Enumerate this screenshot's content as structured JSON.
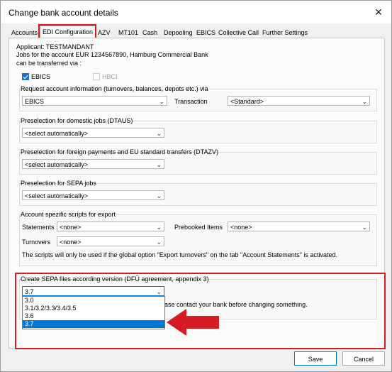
{
  "window": {
    "title": "Change bank account details",
    "close_glyph": "✕"
  },
  "tabs": [
    {
      "label": "Accounts"
    },
    {
      "label": "EDI Configuration"
    },
    {
      "label": "AZV"
    },
    {
      "label": "MT101"
    },
    {
      "label": "Cash"
    },
    {
      "label": "Depooling"
    },
    {
      "label": "EBICS"
    },
    {
      "label": "Collective Call"
    },
    {
      "label": "Further Settings"
    }
  ],
  "header": {
    "applicant": "Applicant: TESTMANDANT",
    "jobs_line": "Jobs for the account EUR 1234567890, Hamburg Commercial Bank",
    "transfer_line": "can be transferred via :",
    "ebics_label": "EBICS",
    "hbci_label": "HBCI"
  },
  "request_info": {
    "legend": "Request account information (turnovers, balances, depots etc.) via",
    "channel_value": "EBICS",
    "transaction_label": "Transaction",
    "transaction_value": "<Standard>"
  },
  "domestic": {
    "legend": "Preselection for domestic jobs (DTAUS)",
    "value": "<select automatically>"
  },
  "foreign": {
    "legend": "Preselection for foreign payments and EU standard transfers (DTAZV)",
    "value": "<select automatically>"
  },
  "sepa_jobs": {
    "legend": "Preselection for SEPA jobs",
    "value": "<select automatically>"
  },
  "scripts": {
    "legend": "Account spezific scripts for export",
    "statements_label": "Statements",
    "statements_value": "<none>",
    "prebooked_label": "Prebooked Items",
    "prebooked_value": "<none>",
    "turnovers_label": "Turnovers",
    "turnovers_value": "<none>",
    "note": "The scripts will only be used if the global option \"Export turnovers\" on the tab \"Account Statements\" is activated."
  },
  "sepa_version": {
    "legend": "Create SEPA files according  version (DFÜ agreement, appendix 3)",
    "value": "3.7",
    "hint_partial": "ase contact your bank before changing something.",
    "options": [
      "3.0",
      "3.1/3.2/3.3/3.4/3.5",
      "3.6",
      "3.7"
    ],
    "selected_option": "3.7"
  },
  "buttons": {
    "save": "Save",
    "cancel": "Cancel"
  },
  "colors": {
    "highlight_red": "#d51b24",
    "selection_blue": "#0078d7",
    "checkbox_blue": "#1a73c8"
  },
  "icons": {
    "chevron": "⌄"
  }
}
